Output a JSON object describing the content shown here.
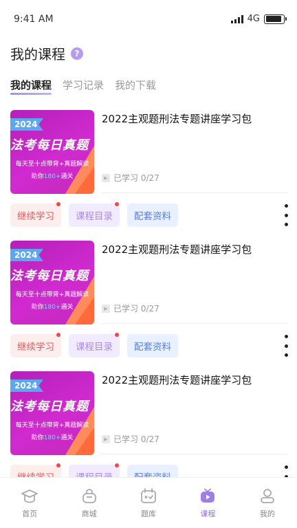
{
  "status_bar": {
    "time": "9:41 AM",
    "network": "4G",
    "battery_level": 0.9
  },
  "header": {
    "title": "我的课程",
    "help_glyph": "?"
  },
  "tabs": [
    {
      "label": "我的课程",
      "active": true
    },
    {
      "label": "学习记录",
      "active": false
    },
    {
      "label": "我的下载",
      "active": false
    }
  ],
  "courses": [
    {
      "title": "2022主观题刑法专题讲座学习包",
      "progress": "已学习 0/27",
      "thumb": {
        "year": "2024",
        "title": "法考每日真题",
        "line1": "每天至十点带背+真题解读",
        "line2_prefix": "助你",
        "line2_highlight": "180+",
        "line2_suffix": "通关"
      },
      "buttons": {
        "continue": "继续学习",
        "catalog": "课程目录",
        "material": "配套资料"
      }
    },
    {
      "title": "2022主观题刑法专题讲座学习包",
      "progress": "已学习 0/27",
      "thumb": {
        "year": "2024",
        "title": "法考每日真题",
        "line1": "每天至十点带背+真题解读",
        "line2_prefix": "助你",
        "line2_highlight": "180+",
        "line2_suffix": "通关"
      },
      "buttons": {
        "continue": "继续学习",
        "catalog": "课程目录",
        "material": "配套资料"
      }
    },
    {
      "title": "2022主观题刑法专题讲座学习包",
      "progress": "已学习 0/27",
      "thumb": {
        "year": "2024",
        "title": "法考每日真题",
        "line1": "每天至十点带背+真题解读",
        "line2_prefix": "助你",
        "line2_highlight": "180+",
        "line2_suffix": "通关"
      },
      "buttons": {
        "continue": "继续学习",
        "catalog": "课程目录",
        "material": "配套资料"
      }
    }
  ],
  "bottom_nav": [
    {
      "label": "首页",
      "icon": "graduation-cap-icon",
      "active": false
    },
    {
      "label": "商城",
      "icon": "shopping-bag-icon",
      "active": false
    },
    {
      "label": "题库",
      "icon": "question-bank-icon",
      "active": false
    },
    {
      "label": "课程",
      "icon": "video-play-icon",
      "active": true
    },
    {
      "label": "我的",
      "icon": "user-icon",
      "active": false
    }
  ],
  "colors": {
    "accent": "#8e6de0",
    "continue": "#e05a5a",
    "catalog": "#a98ae6",
    "material": "#5b7fd6",
    "badge_dot": "#f04848"
  }
}
